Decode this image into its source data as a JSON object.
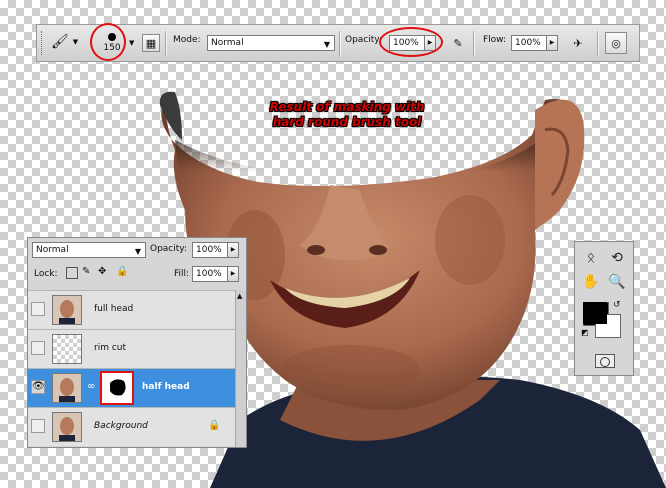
{
  "caption": {
    "line1": "Result of masking with",
    "line2": "hard round brush tool"
  },
  "options_bar": {
    "brush_size": "150",
    "mode_label": "Mode:",
    "mode_value": "Normal",
    "opacity_label": "Opacity:",
    "opacity_value": "100%",
    "flow_label": "Flow:",
    "flow_value": "100%",
    "highlight_color": "#e01010"
  },
  "layers_panel": {
    "blend_mode": "Normal",
    "opacity_label": "Opacity:",
    "opacity_value": "100%",
    "lock_label": "Lock:",
    "fill_label": "Fill:",
    "fill_value": "100%",
    "layers": [
      {
        "name": "full head",
        "thumb": "face",
        "visible": false,
        "active": false
      },
      {
        "name": "rim cut",
        "thumb": "empty",
        "visible": false,
        "active": false
      },
      {
        "name": "half head",
        "thumb": "face",
        "visible": true,
        "active": true,
        "has_mask": true
      },
      {
        "name": "Background",
        "thumb": "face",
        "visible": false,
        "active": false,
        "locked": true
      }
    ],
    "active_color": "#3e8fdd"
  },
  "tools_panel": {
    "foreground_color": "#000000",
    "background_color": "#ffffff"
  }
}
